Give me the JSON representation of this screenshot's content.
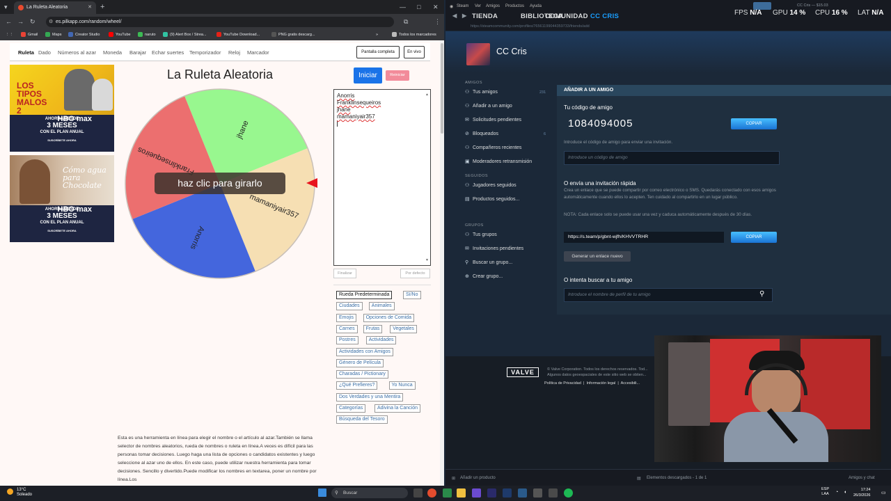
{
  "chrome": {
    "tab_title": "La Ruleta Aleatoria",
    "new_tab": "+",
    "url": "es.pilkapp.com/random/wheel/",
    "bookmarks": [
      "Gmail",
      "Maps",
      "Creator Studio",
      "YouTube",
      "naruto",
      "(9) Alert Box / Strea...",
      "YouTube Download...",
      "PNG gratis descarg..."
    ],
    "bookmark_more": "»",
    "all_bookmarks": "Todos los marcadores",
    "window_controls": [
      "—",
      "□",
      "✕"
    ],
    "nav_buttons": [
      "←",
      "→",
      "↻"
    ]
  },
  "site": {
    "nav": [
      "Ruleta",
      "Dado",
      "Números al azar",
      "Moneda",
      "Barajar",
      "Echar suertes",
      "Temporizador",
      "Reloj",
      "Marcador"
    ],
    "fullscreen": "Pantalla completa",
    "live": "En vivo",
    "title": "La Ruleta Aleatoria",
    "start": "Iniciar",
    "reset": "Reiniciar",
    "overlay": "haz clic para girarlo",
    "names": [
      "Anorris",
      "Franklinsequeiros",
      "jhane",
      "mamaniyair357"
    ],
    "finish": "Finalizar",
    "default": "Por defecto",
    "chips": [
      "Rueda Predeterminada",
      "Sí/No",
      "Ciudades",
      "Animales",
      "Emojis",
      "Opciones de Comida",
      "Carnes",
      "Frutas",
      "Vegetales",
      "Postres",
      "Actividades",
      "Actividades con Amigos",
      "Género de Película",
      "Charadas / Pictionary",
      "¿Qué Prefieres?",
      "Yo Nunca",
      "Dos Verdades y una Mentira",
      "Categorías",
      "Adivina la Canción",
      "Búsqueda del Tesoro"
    ],
    "description": "Esta es una herramienta en línea para elegir el nombre o el artículo al azar.También se llama selector de nombres aleatorios, rueda de nombres o ruleta en línea.A veces es difícil para las personas tomar decisiones. Luego haga una lista de opciones o candidatos existentes y luego seleccione al azar uno de ellos. En este caso, puede utilizar nuestra herramienta para tomar decisiones. Sencillo y divertido.Puede modificar los nombres en textarea, poner un nombre por línea.Los",
    "ad1": {
      "top": "LOS TIPOS MALOS 2",
      "line1": "AHORRA DESDE",
      "big": "3 MESES",
      "line2": "CON EL PLAN ANUAL",
      "brand": "HBO max",
      "cta": "SUSCRÍBETE AHORA"
    },
    "ad2": {
      "top": "Cómo agua para Chocolate",
      "line1": "AHORRA DESDE",
      "big": "3 MESES",
      "line2": "CON EL PLAN ANUAL",
      "brand": "HBO max",
      "cta": "SUSCRÍBETE AHORA"
    }
  },
  "wheel": {
    "segments": [
      {
        "name": "jhane",
        "color": "#98f78f"
      },
      {
        "name": "mamaniyair357",
        "color": "#f6dfb3"
      },
      {
        "name": "Anorris",
        "color": "#4466dd"
      },
      {
        "name": "Franklinsequeiros",
        "color": "#ec6f6f"
      }
    ],
    "pointer_color": "#e8141e"
  },
  "steam": {
    "menu": [
      "Steam",
      "Ver",
      "Amigos",
      "Productos",
      "Ayuda"
    ],
    "nav": [
      "TIENDA",
      "BIBLIOTECA",
      "COMUNIDAD",
      "CC CRIS"
    ],
    "balance": "CC Cris — $15.03",
    "perf": [
      {
        "k": "FPS",
        "v": "N/A"
      },
      {
        "k": "GPU",
        "v": "14 %"
      },
      {
        "k": "CPU",
        "v": "16 %"
      },
      {
        "k": "LAT",
        "v": "N/A"
      }
    ],
    "url": "https://steamcommunity.com/profiles/76561199044359733/friends/add",
    "profile_name": "CC Cris",
    "sections": {
      "friends": "AMIGOS",
      "following": "SEGUIDOS",
      "groups": "GRUPOS"
    },
    "friends_items": [
      "Tus amigos",
      "Añadir a un amigo",
      "Solicitudes pendientes",
      "Bloqueados",
      "Compañeros recientes",
      "Moderadores retransmisión"
    ],
    "friends_count": "231",
    "blocked_count": "6",
    "following_items": [
      "Jugadores seguidos",
      "Productos seguidos..."
    ],
    "group_items": [
      "Tus grupos",
      "Invitaciones pendientes",
      "Buscar un grupo...",
      "Crear grupo..."
    ],
    "panel_header": "AÑADIR A UN AMIGO",
    "code_heading": "Tu código de amigo",
    "code": "1084094005",
    "copy": "COPIAR",
    "code_hint": "Introduce el código de amigo para enviar una invitación.",
    "code_placeholder": "Introduce un código de amigo",
    "invite_heading": "O envía una invitación rápida",
    "invite_text": "Crea un enlace que se puede compartir por correo electrónico o SMS. Quedarás conectado con esos amigos automáticamente cuando ellos lo acepten. Ten cuidado al compartirlo en un lugar público.",
    "invite_note": "NOTA: Cada enlace solo se puede usar una vez y caduca automáticamente después de 30 días.",
    "invite_link": "https://s.team/p/gbnt-wjfh/KHVVTRHR",
    "generate": "Generar un enlace nuevo",
    "search_heading": "O intenta buscar a tu amigo",
    "search_placeholder": "Introduce el nombre de perfil de tu amigo",
    "footer_copy": "© Valve Corporation. Todos los derechos reservados. Tod... Algunos datos geoespaciales de este sitio web se obtien...",
    "footer_links": [
      "Política de Privacidad",
      "Información legal",
      "Accesibili..."
    ],
    "valve": "VALVE",
    "add_product": "Añadir un producto",
    "downloads": "Elementos descargados - 1 de 1",
    "friends_chat": "Amigos y chat"
  },
  "taskbar": {
    "temp": "13°C",
    "weather": "Soleado",
    "search": "Buscar",
    "lang1": "ESP",
    "lang2": "LAA",
    "time": "17:24",
    "date": "26/3/2026"
  }
}
